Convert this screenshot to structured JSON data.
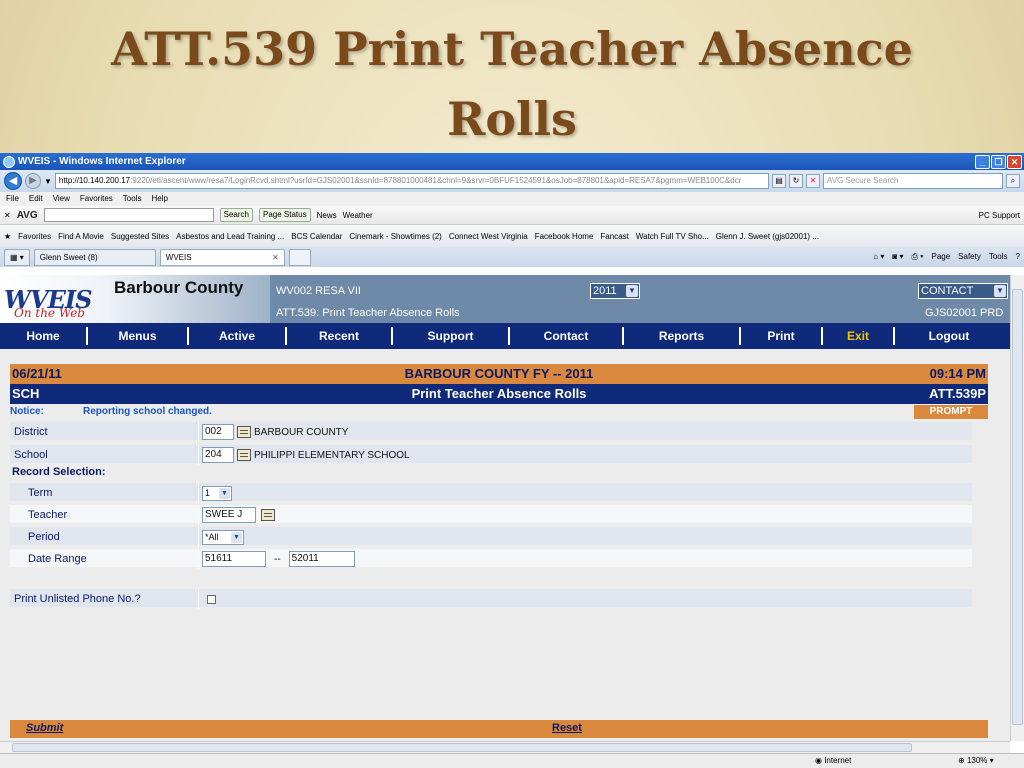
{
  "slide": {
    "title_line1": "ATT.539 Print Teacher Absence",
    "title_line2": "Rolls"
  },
  "browser": {
    "window_title": "WVEIS - Windows Internet Explorer",
    "url_host": "http://10.140.200.17",
    "url_rest": ":9220/etl/ascent/www/resa7/LoginRcvd.shtml?usrId=GJS02001&ssnId=878801000481&chnl=9&srvr=0BFUF1524591&osJob=878801&apid=RESA7&pgmm=WEB100C&dcr",
    "search_placeholder": "AVG Secure Search",
    "menu": [
      "File",
      "Edit",
      "View",
      "Favorites",
      "Tools",
      "Help"
    ],
    "toolbar": {
      "avg_label": "AVG",
      "search_btn": "Search",
      "page_status_btn": "Page Status",
      "news": "News",
      "weather": "Weather",
      "pc_support": "PC Support"
    },
    "favorites_label": "Favorites",
    "favorites": [
      "Find A Movie",
      "Suggested Sites",
      "Asbestos and Lead Training ...",
      "BCS Calendar",
      "Cinemark - Showtimes (2)",
      "Connect West Virginia",
      "Facebook Home",
      "Fancast",
      "Watch Full TV Sho...",
      "Glenn J. Sweet (gjs02001) ..."
    ],
    "tabs": [
      "Glenn Sweet (8)",
      "WVEIS"
    ],
    "command_bar": [
      "Page",
      "Safety",
      "Tools"
    ],
    "status_zone": "Internet",
    "zoom": "130%"
  },
  "app": {
    "logo": "WVEIS",
    "logo_sub": "On the Web",
    "county": "Barbour County",
    "org": "WV002 RESA VII",
    "page_name": "ATT.539: Print Teacher Absence Rolls",
    "year": "2011",
    "contact_dropdown": "CONTACT",
    "user_code": "GJS02001 PRD",
    "nav": [
      "Home",
      "Menus",
      "Active",
      "Recent",
      "Support",
      "Contact",
      "Reports",
      "Print",
      "Exit",
      "Logout"
    ]
  },
  "form": {
    "date": "06/21/11",
    "banner": "BARBOUR COUNTY FY -- 2011",
    "time": "09:14 PM",
    "scope": "SCH",
    "form_title": "Print Teacher Absence Rolls",
    "program_id": "ATT.539P",
    "notice_label": "Notice:",
    "notice_text": "Reporting school changed.",
    "prompt_tag": "PROMPT",
    "district_label": "District",
    "district_code": "002",
    "district_name": "BARBOUR COUNTY",
    "school_label": "School",
    "school_code": "204",
    "school_name": "PHILIPPI ELEMENTARY SCHOOL",
    "record_selection": "Record Selection:",
    "term_label": "Term",
    "term_value": "1",
    "teacher_label": "Teacher",
    "teacher_value": "SWEE J",
    "period_label": "Period",
    "period_value": "*All",
    "date_range_label": "Date Range",
    "date_from": "51611",
    "date_sep": "--",
    "date_to": "52011",
    "phone_label": "Print Unlisted Phone No.?",
    "submit": "Submit",
    "reset": "Reset"
  }
}
